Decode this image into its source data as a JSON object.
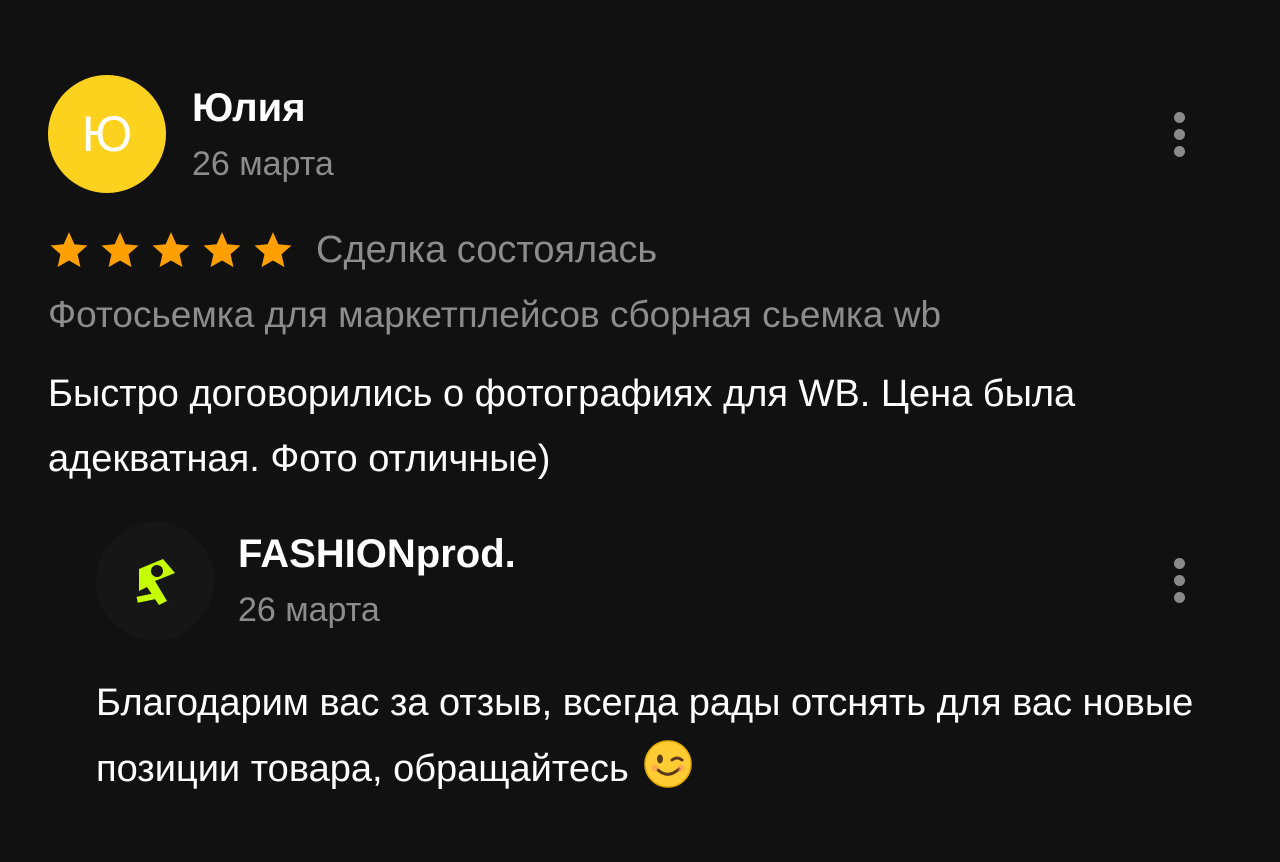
{
  "review": {
    "avatar_letter": "Ю",
    "author": "Юлия",
    "date": "26 марта",
    "rating": 5,
    "rating_max": 5,
    "status": "Сделка состоялась",
    "service": "Фотосьемка для маркетплейсов сборная сьемка wb",
    "text": "Быстро договорились о фотографиях для WB. Цена была адекватная. Фото отличные)",
    "more_icon": "more-vertical-icon"
  },
  "reply": {
    "author": "FASHIONprod.",
    "date": "26 марта",
    "text": "Благодарим вас за отзыв, всегда рады отснять для вас новые позиции товара, обращайтесь",
    "emoji_icon": "winking-face-icon",
    "logo_icon": "fashionprod-logo-icon",
    "more_icon": "more-vertical-icon"
  },
  "colors": {
    "background": "#111111",
    "avatar": "#fdd21e",
    "star": "#ff9f00",
    "secondary_text": "#8c8c8c",
    "logo_accent": "#c6ff00"
  }
}
